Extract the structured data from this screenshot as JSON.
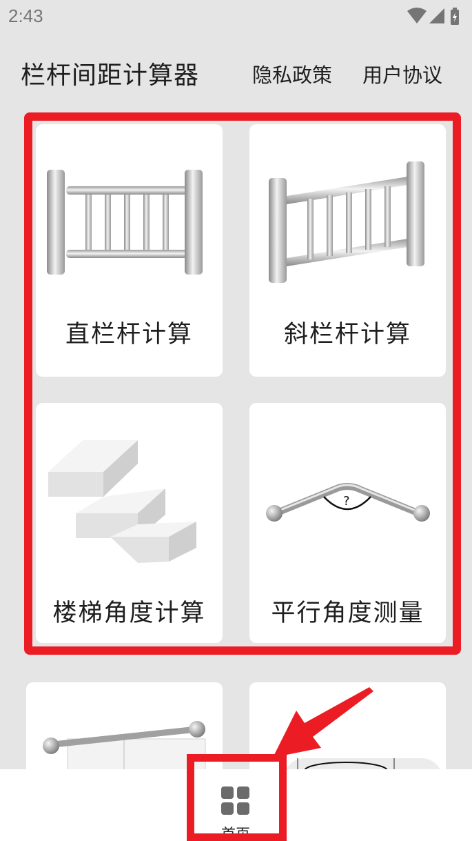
{
  "status_bar": {
    "time": "2:43",
    "icons": [
      "wifi-icon",
      "cell-signal-icon",
      "battery-charging-icon"
    ]
  },
  "header": {
    "title": "栏杆间距计算器",
    "privacy_link": "隐私政策",
    "agreement_link": "用户协议"
  },
  "cards": [
    {
      "label": "直栏杆计算",
      "icon": "straight-railing-icon"
    },
    {
      "label": "斜栏杆计算",
      "icon": "slanted-railing-icon"
    },
    {
      "label": "楼梯角度计算",
      "icon": "staircase-icon"
    },
    {
      "label": "平行角度测量",
      "icon": "angled-handrail-icon"
    },
    {
      "label": "",
      "icon": "protractor-handrail-icon"
    },
    {
      "label": "",
      "icon": "pipe-measure-icon"
    }
  ],
  "bottom_nav": {
    "home_label": "首页",
    "home_icon": "grid-icon"
  },
  "colors": {
    "highlight": "#ec1c24",
    "background": "#e5e5e5",
    "card": "#ffffff",
    "status_text": "#757575"
  }
}
